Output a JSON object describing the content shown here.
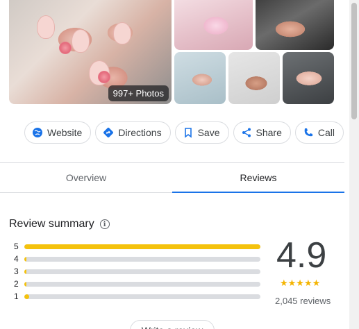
{
  "photos": {
    "count_badge": "997+ Photos"
  },
  "actions": [
    {
      "label": "Website",
      "icon": "globe-icon"
    },
    {
      "label": "Directions",
      "icon": "directions-icon"
    },
    {
      "label": "Save",
      "icon": "bookmark-icon"
    },
    {
      "label": "Share",
      "icon": "share-icon"
    },
    {
      "label": "Call",
      "icon": "phone-icon"
    }
  ],
  "tabs": [
    {
      "label": "Overview",
      "active": false
    },
    {
      "label": "Reviews",
      "active": true
    }
  ],
  "review_summary": {
    "title": "Review summary",
    "distribution": [
      {
        "stars": "5",
        "fraction": 1.0
      },
      {
        "stars": "4",
        "fraction": 0.01
      },
      {
        "stars": "3",
        "fraction": 0.005
      },
      {
        "stars": "2",
        "fraction": 0.005
      },
      {
        "stars": "1",
        "fraction": 0.02
      }
    ],
    "rating": "4.9",
    "stars_display": "★★★★★",
    "review_count": "2,045 reviews"
  },
  "write_review_label": "Write a review",
  "colors": {
    "accent": "#1a73e8",
    "star": "#f4c20d"
  }
}
